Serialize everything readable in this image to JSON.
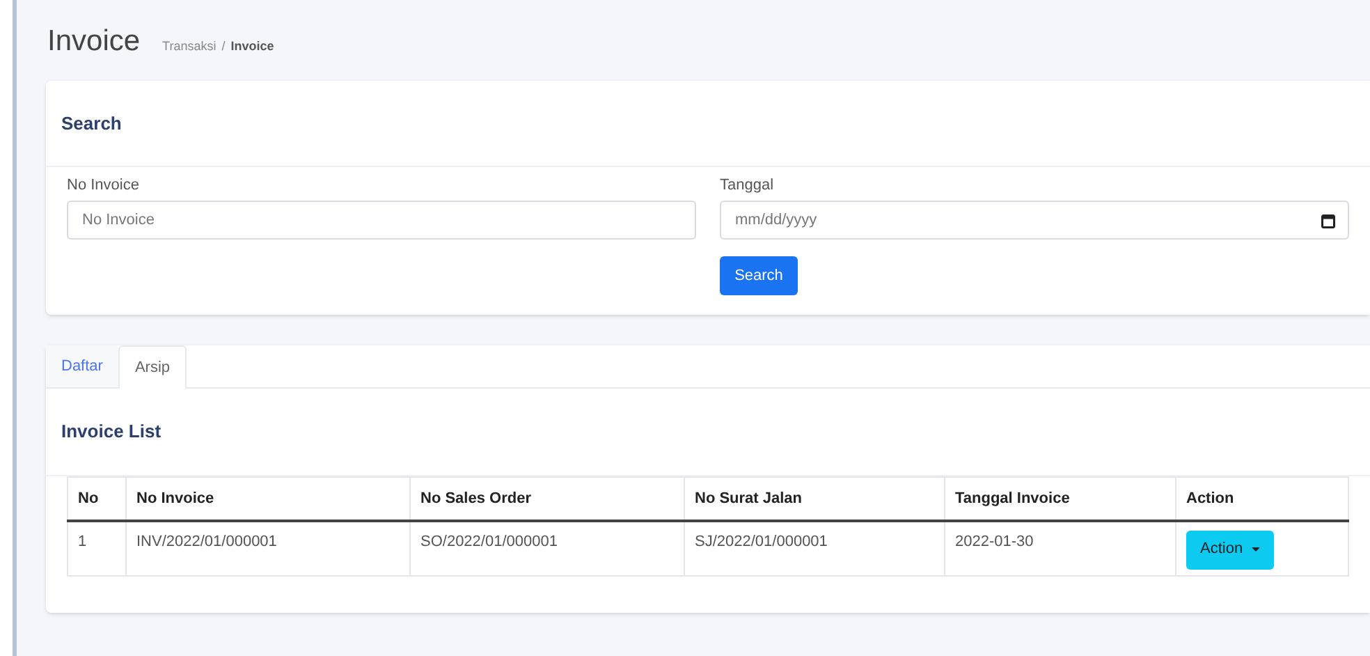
{
  "header": {
    "title": "Invoice",
    "breadcrumb": [
      {
        "label": "Transaksi",
        "current": false
      },
      {
        "label": "Invoice",
        "current": true
      }
    ],
    "separator": "/"
  },
  "search": {
    "title": "Search",
    "fields": [
      {
        "label": "No Invoice",
        "kind": "text",
        "placeholder": "No Invoice"
      },
      {
        "label": "Tanggal",
        "kind": "date",
        "placeholder": "mm/dd/yyyy"
      }
    ],
    "button": "Search"
  },
  "tabs": [
    {
      "label": "Daftar",
      "selected": false
    },
    {
      "label": "Arsip",
      "selected": true
    }
  ],
  "list": {
    "title": "Invoice List",
    "columns": [
      "No",
      "No Invoice",
      "No Sales Order",
      "No Surat Jalan",
      "Tanggal Invoice",
      "Action"
    ],
    "rows": [
      {
        "cells": [
          "1",
          "INV/2022/01/000001",
          "SO/2022/01/000001",
          "SJ/2022/01/000001",
          "2022-01-30"
        ],
        "action": "Action"
      }
    ]
  }
}
